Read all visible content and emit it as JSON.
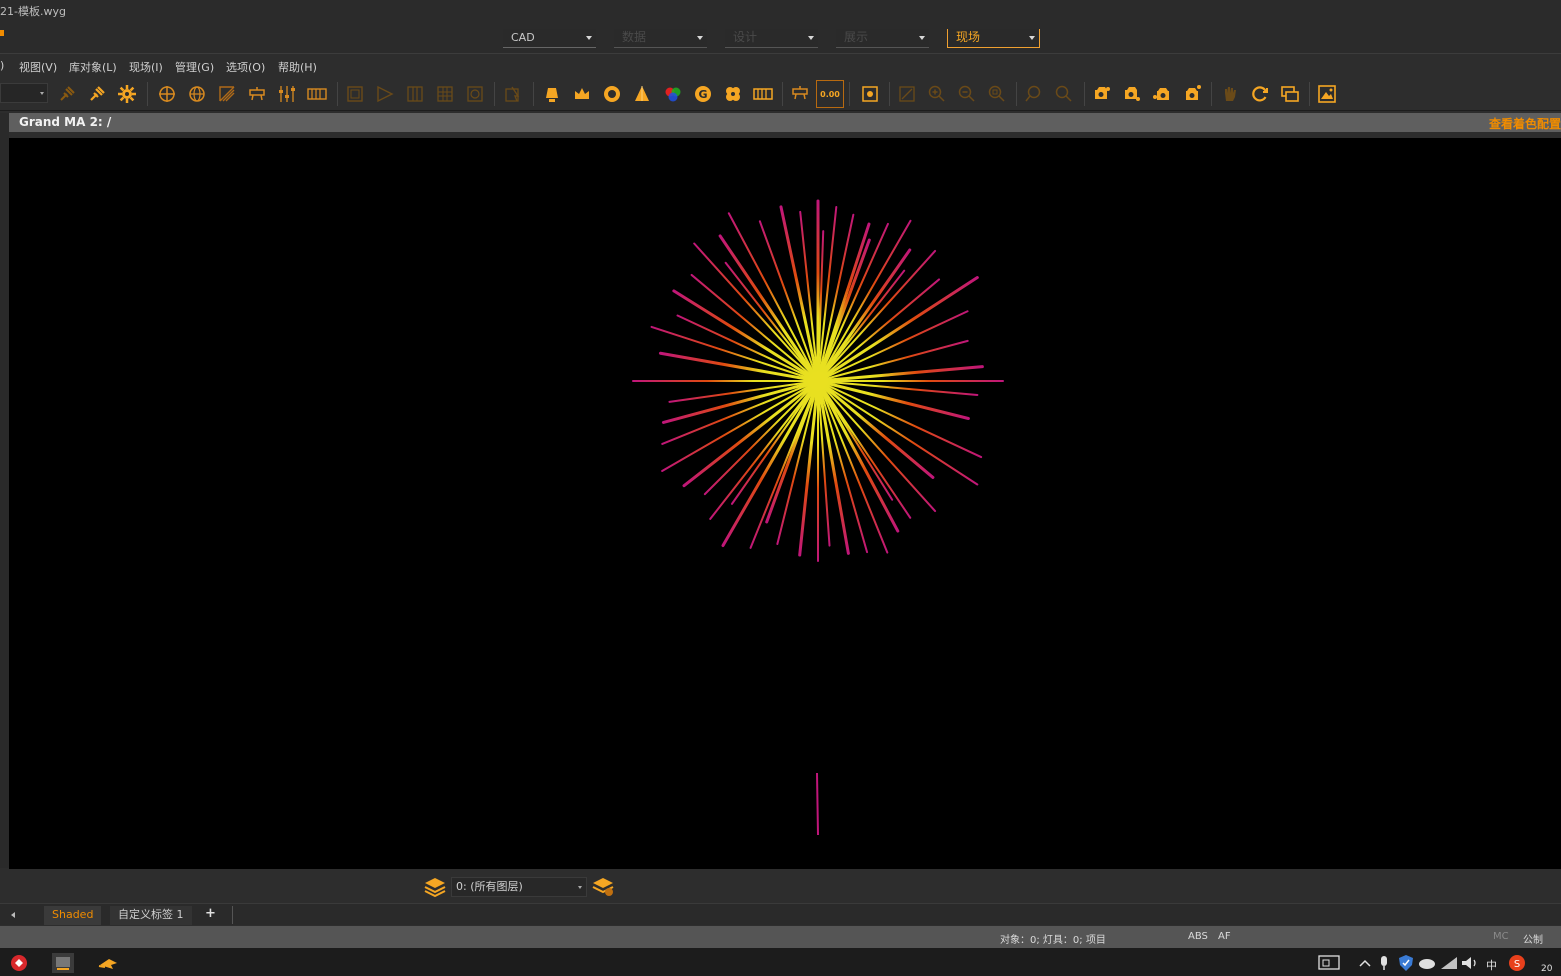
{
  "window": {
    "title": "21-模板.wyg"
  },
  "modes": [
    {
      "label": "CAD",
      "state": "normal"
    },
    {
      "label": "数据",
      "state": "disabled"
    },
    {
      "label": "设计",
      "state": "disabled"
    },
    {
      "label": "展示",
      "state": "disabled"
    },
    {
      "label": "现场",
      "state": "active"
    }
  ],
  "menu": [
    {
      "label": ")"
    },
    {
      "label": "视图(V)"
    },
    {
      "label": "库对象(L)"
    },
    {
      "label": "现场(I)"
    },
    {
      "label": "管理(G)"
    },
    {
      "label": "选项(O)"
    },
    {
      "label": "帮助(H)"
    }
  ],
  "toolbar": {
    "icons": [
      "plug-icon",
      "plug-active-icon",
      "gear-icon",
      "crosshair-icon",
      "globe-icon",
      "beam-icon",
      "truss-icon",
      "fader-icon",
      "dmx-bank-icon",
      "frame-icon",
      "slide-icon",
      "columns-icon",
      "grid-icon",
      "loop-icon",
      "cursor-icon",
      "lamp-icon",
      "crown-icon",
      "iris-icon",
      "cone-icon",
      "color-wheel-icon",
      "gobo-icon",
      "prism-icon",
      "film-icon",
      "dimmer-icon",
      "value-readout-icon",
      "snapshot-icon",
      "zoom-extents-icon",
      "zoom-in-icon",
      "zoom-out-icon",
      "zoom-window-icon",
      "zoom-prev-icon",
      "zoom-next-icon",
      "camera-left-icon",
      "camera-right-icon",
      "camera-top-icon",
      "camera-front-icon",
      "hand-icon",
      "refresh-icon",
      "window-icon",
      "image-icon"
    ],
    "value_readout": "0.00"
  },
  "viewport": {
    "title": "Grand MA 2: /",
    "right_label": "查看着色配置",
    "render_mode": "beams"
  },
  "layer_bar": {
    "current_layer": "0: (所有图层)"
  },
  "tabs": [
    {
      "label": "Shaded",
      "active": true
    },
    {
      "label": "自定义标签 1",
      "active": false
    }
  ],
  "tab_add": "+",
  "status": {
    "counts": "对象：0; 灯具：0; 项目",
    "abs": "ABS",
    "af": "AF",
    "mc": "MC",
    "units": "公制"
  },
  "taskbar": {
    "tray_ime": "中",
    "year_fragment": "20"
  },
  "colors": {
    "accent": "#f08c00",
    "beam_core": "#e8e020",
    "beam_mid": "#e04a10",
    "beam_tip": "#c0167a"
  }
}
